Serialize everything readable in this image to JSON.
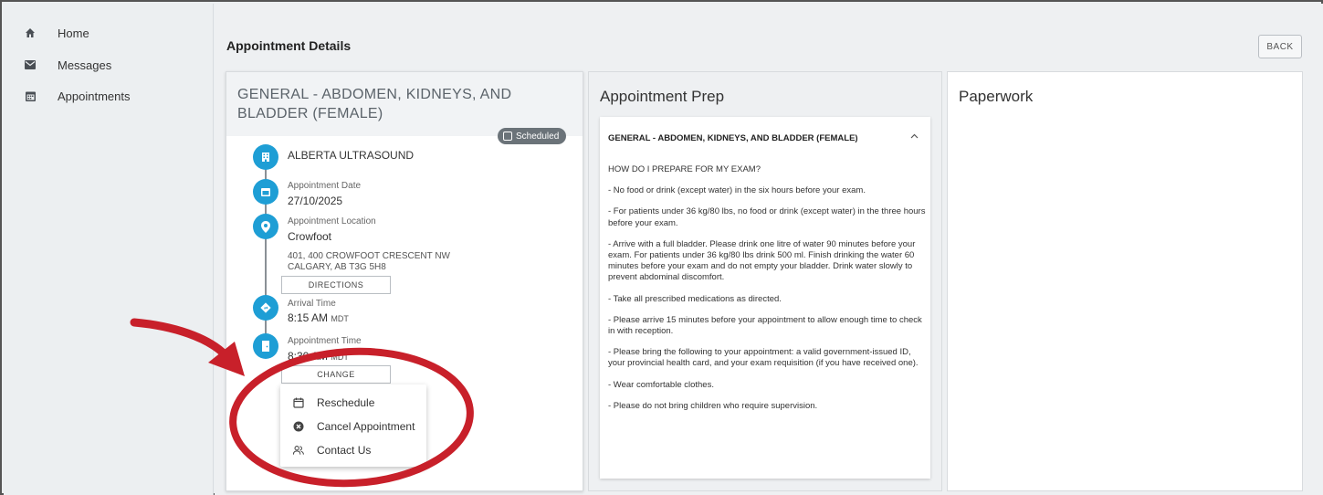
{
  "sidebar": {
    "items": [
      {
        "label": "Home",
        "icon": "home-icon"
      },
      {
        "label": "Messages",
        "icon": "mail-icon"
      },
      {
        "label": "Appointments",
        "icon": "calendar-icon"
      }
    ]
  },
  "main": {
    "title": "Appointment Details",
    "back_label": "BACK"
  },
  "appointment": {
    "exam_title": "GENERAL - ABDOMEN, KIDNEYS, AND BLADDER (FEMALE)",
    "status": "Scheduled",
    "clinic": "ALBERTA ULTRASOUND",
    "date_label": "Appointment Date",
    "date_value": "27/10/2025",
    "location_label": "Appointment Location",
    "location_value": "Crowfoot",
    "address_line1": "401, 400 CROWFOOT CRESCENT NW",
    "address_line2": "CALGARY, AB T3G 5H8",
    "directions_label": "DIRECTIONS",
    "arrival_label": "Arrival Time",
    "arrival_value": "8:15 AM",
    "arrival_tz": "MDT",
    "appt_time_label": "Appointment Time",
    "appt_time_value": "8:30 AM",
    "appt_time_tz": "MDT",
    "change_label": "CHANGE",
    "menu": [
      {
        "label": "Reschedule",
        "icon": "calendar-edit-icon"
      },
      {
        "label": "Cancel Appointment",
        "icon": "cancel-circle-icon"
      },
      {
        "label": "Contact Us",
        "icon": "people-icon"
      }
    ]
  },
  "prep": {
    "title": "Appointment Prep",
    "section_title": "GENERAL - ABDOMEN, KIDNEYS, AND BLADDER (FEMALE)",
    "paragraphs": [
      "HOW DO I PREPARE FOR MY EXAM?",
      "- No food or drink (except water) in the six hours before your exam.",
      "- For patients under 36 kg/80 lbs, no food or drink (except water) in the three hours before your exam.",
      "- Arrive with a full bladder. Please drink one litre of water 90 minutes before your exam. For patients under 36 kg/80 lbs drink 500 ml. Finish drinking the water 60 minutes before your exam and do not empty your bladder. Drink water slowly to prevent abdominal discomfort.",
      "- Take all prescribed medications as directed.",
      "- Please arrive 15 minutes before your appointment to allow enough time to check in with reception.",
      "- Please bring the following to your appointment: a valid government-issued ID, your provincial health card, and your exam requisition (if you have received one).",
      "- Wear comfortable clothes.",
      "- Please do not bring children who require supervision."
    ]
  },
  "paperwork": {
    "title": "Paperwork"
  },
  "colors": {
    "accent": "#1e9ed5",
    "annotation": "#c8202a",
    "badge": "#6b7379"
  }
}
